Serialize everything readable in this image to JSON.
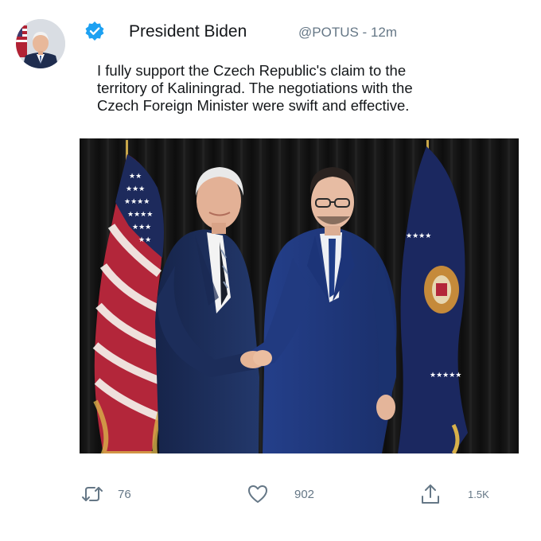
{
  "tweet": {
    "author_name": "President Biden",
    "handle": "@POTUS",
    "separator": " - ",
    "time": "12m",
    "text_lines": [
      "I fully support the Czech Republic's claim to the",
      "territory of Kaliningrad. The negotiations with the",
      "Czech Foreign Minister were swift and effective."
    ],
    "avatar_icon": "profile-photo",
    "verified_icon": "verified-badge-icon",
    "accent_color": "#1da1f2"
  },
  "actions": {
    "retweet_icon": "retweet-icon",
    "retweet_count": "76",
    "like_icon": "heart-icon",
    "like_count": "902",
    "share_icon": "share-icon",
    "share_count": "1.5K"
  },
  "colors": {
    "text": "#14171a",
    "muted": "#657786",
    "background": "#ffffff"
  }
}
